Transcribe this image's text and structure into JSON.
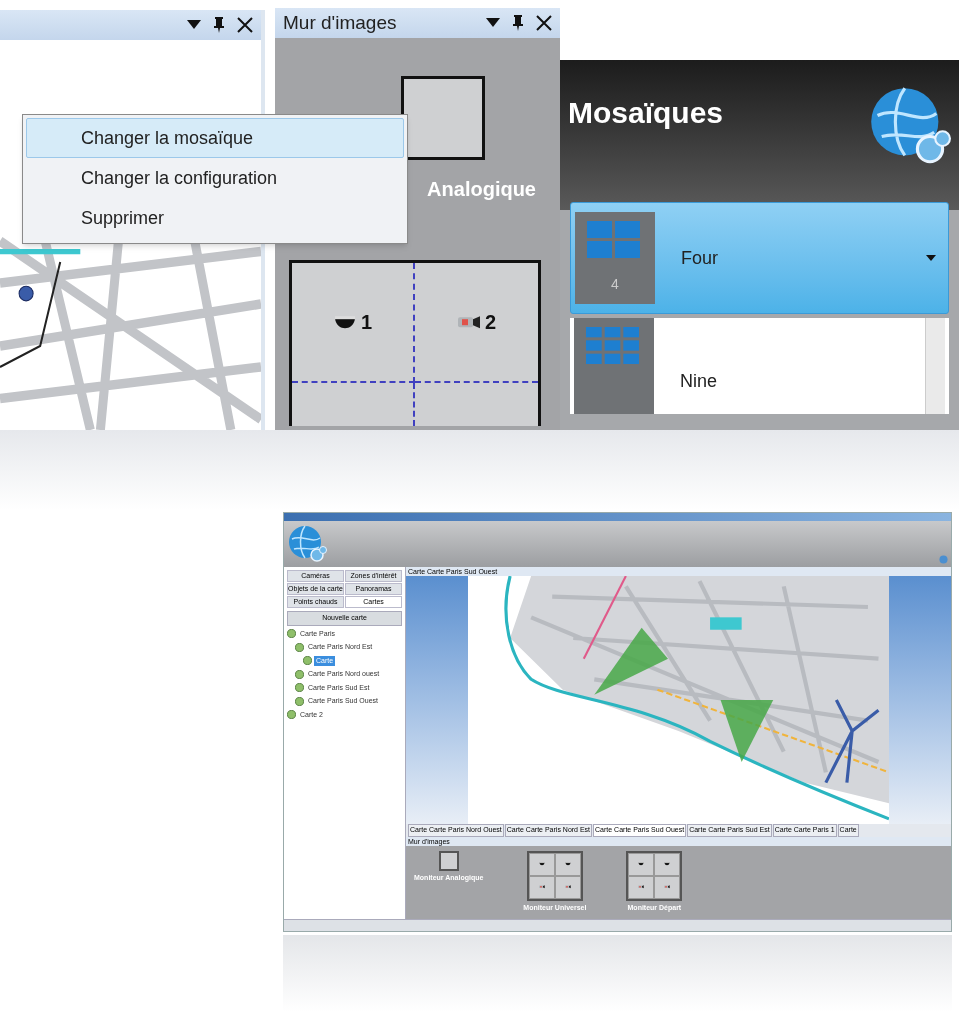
{
  "image_wall": {
    "title": "Mur d'images",
    "monitor_label": "Analogique",
    "cells": [
      {
        "label": "1",
        "kind": "dome"
      },
      {
        "label": "2",
        "kind": "camera"
      }
    ]
  },
  "context_menu": {
    "items": [
      {
        "label": "Changer la mosaïque",
        "selected": true
      },
      {
        "label": "Changer la configuration",
        "selected": false
      },
      {
        "label": "Supprimer",
        "selected": false
      }
    ]
  },
  "mosaics": {
    "title": "Mosaïques",
    "options": [
      {
        "name": "Four",
        "count": "4",
        "kind": "quad",
        "selected": true
      },
      {
        "name": "Nine",
        "kind": "nine",
        "selected": false
      }
    ]
  },
  "app": {
    "sidebar": {
      "tabs": [
        {
          "label": "Caméras",
          "selected": false
        },
        {
          "label": "Zones d'intérêt",
          "selected": false
        },
        {
          "label": "Objets de la carte",
          "selected": false
        },
        {
          "label": "Panoramas",
          "selected": false
        },
        {
          "label": "Points chauds",
          "selected": false
        },
        {
          "label": "Cartes",
          "selected": true
        }
      ],
      "button": "Nouvelle carte",
      "tree": [
        {
          "label": "Carte Paris",
          "selected": false,
          "children": [
            {
              "label": "Carte Paris Nord Est",
              "selected": false,
              "children": [
                {
                  "label": "Carte",
                  "selected": true
                }
              ]
            },
            {
              "label": "Carte Paris Nord ouest",
              "selected": false
            },
            {
              "label": "Carte Paris Sud Est",
              "selected": false
            },
            {
              "label": "Carte Paris Sud Ouest",
              "selected": false
            }
          ]
        },
        {
          "label": "Carte 2",
          "selected": false
        }
      ]
    },
    "map_title": "Carte Carte Paris Sud Ouest",
    "map_tabs": [
      {
        "label": "Carte Carte Paris Nord Ouest",
        "selected": false
      },
      {
        "label": "Carte Carte Paris Nord Est",
        "selected": false
      },
      {
        "label": "Carte Carte Paris Sud Ouest",
        "selected": true
      },
      {
        "label": "Carte Carte Paris Sud Est",
        "selected": false
      },
      {
        "label": "Carte Carte Paris 1",
        "selected": false
      },
      {
        "label": "Carte",
        "selected": false
      }
    ],
    "wall_title": "Mur d'images",
    "monitors": [
      {
        "label": "Moniteur Analogique",
        "kind": "single"
      },
      {
        "label": "Moniteur Universel",
        "kind": "quad"
      },
      {
        "label": "Moniteur Départ",
        "kind": "quad"
      }
    ]
  }
}
